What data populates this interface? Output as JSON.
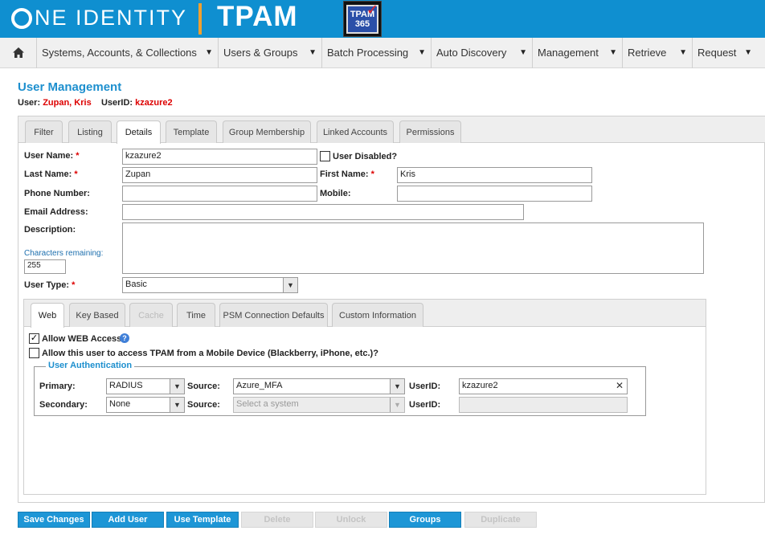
{
  "header": {
    "brand": "NE IDENTITY",
    "product": "TPAM",
    "badge_text": "TPAM 365"
  },
  "menu": {
    "items": [
      {
        "label": "Systems, Accounts, & Collections"
      },
      {
        "label": "Users & Groups"
      },
      {
        "label": "Batch Processing"
      },
      {
        "label": "Auto Discovery"
      },
      {
        "label": "Management"
      },
      {
        "label": "Retrieve"
      },
      {
        "label": "Request"
      }
    ]
  },
  "page": {
    "title": "User Management",
    "user_label": "User:",
    "user_value": "Zupan, Kris",
    "userid_label": "UserID:",
    "userid_value": "kzazure2"
  },
  "tabs": [
    {
      "label": "Filter"
    },
    {
      "label": "Listing"
    },
    {
      "label": "Details"
    },
    {
      "label": "Template"
    },
    {
      "label": "Group Membership"
    },
    {
      "label": "Linked Accounts"
    },
    {
      "label": "Permissions"
    }
  ],
  "form": {
    "user_name_label": "User Name:",
    "user_name_value": "kzazure2",
    "user_disabled_label": "User Disabled?",
    "user_disabled_checked": false,
    "last_name_label": "Last Name:",
    "last_name_value": "Zupan",
    "first_name_label": "First Name:",
    "first_name_value": "Kris",
    "phone_label": "Phone Number:",
    "phone_value": "",
    "mobile_label": "Mobile:",
    "mobile_value": "",
    "email_label": "Email Address:",
    "email_value": "",
    "description_label": "Description:",
    "description_value": "",
    "chars_remaining_label": "Characters remaining:",
    "chars_remaining_value": "255",
    "user_type_label": "User Type:",
    "user_type_value": "Basic",
    "required_mark": "*"
  },
  "subtabs": [
    {
      "label": "Web"
    },
    {
      "label": "Key Based"
    },
    {
      "label": "Cache"
    },
    {
      "label": "Time"
    },
    {
      "label": "PSM Connection Defaults"
    },
    {
      "label": "Custom Information"
    }
  ],
  "web": {
    "allow_web_label": "Allow WEB Access",
    "allow_web_checked": true,
    "allow_mobile_label": "Allow this user to access TPAM from a Mobile Device (Blackberry, iPhone, etc.)?",
    "allow_mobile_checked": false,
    "auth_legend": "User Authentication",
    "primary_label": "Primary:",
    "primary_value": "RADIUS",
    "source_label": "Source:",
    "primary_source_value": "Azure_MFA",
    "userid_label": "UserID:",
    "primary_userid_value": "kzazure2",
    "secondary_label": "Secondary:",
    "secondary_value": "None",
    "secondary_source_placeholder": "Select a system",
    "secondary_userid_value": ""
  },
  "buttons": [
    {
      "label": "Save Changes",
      "enabled": true
    },
    {
      "label": "Add User",
      "enabled": true
    },
    {
      "label": "Use Template",
      "enabled": true
    },
    {
      "label": "Delete",
      "enabled": false
    },
    {
      "label": "Unlock",
      "enabled": false
    },
    {
      "label": "Groups",
      "enabled": true
    },
    {
      "label": "Duplicate",
      "enabled": false
    }
  ],
  "colors": {
    "header_bg": "#0f8fd0",
    "accent": "#1d8fce",
    "required": "#dd0000",
    "button_bg": "#1d96d6"
  }
}
